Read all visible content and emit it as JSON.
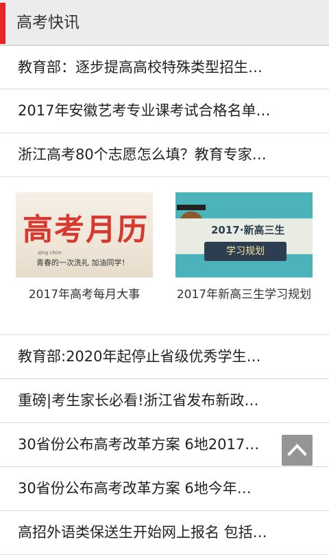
{
  "header": {
    "title": "高考快讯",
    "accent_color": "#e2262a"
  },
  "top_news": [
    "教育部：逐步提高高校特殊类型招生…",
    "2017年安徽艺考专业课考试合格名单…",
    "浙江高考80个志愿怎么填？教育专家…"
  ],
  "promos": [
    {
      "thumb_main": "高考月历",
      "thumb_pinyin": "qīng chūn",
      "thumb_sub": "青春的一次洗礼 加油同学！",
      "caption": "2017年高考每月大事"
    },
    {
      "thumb_main": "2017·新高三生",
      "thumb_sub": "学习规划",
      "caption": "2017年新高三生学习规划"
    }
  ],
  "bottom_news": [
    "教育部:2020年起停止省级优秀学生…",
    "重磅|考生家长必看!浙江省发布新政…",
    "30省份公布高考改革方案 6地2017…",
    "30省份公布高考改革方案 6地今年…",
    "高招外语类保送生开始网上报名 包括…"
  ],
  "back_to_top": {
    "icon": "chevron-up-icon"
  }
}
